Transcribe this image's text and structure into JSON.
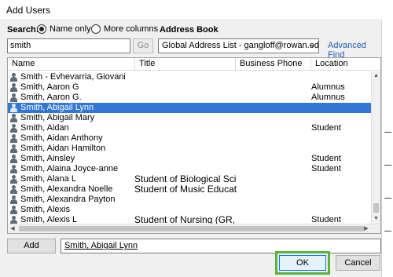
{
  "window": {
    "title": "Add Users"
  },
  "search": {
    "label": "Search:",
    "mode_options": [
      {
        "label": "Name only",
        "checked": true
      },
      {
        "label": "More columns",
        "checked": false
      }
    ],
    "value": "smith",
    "go_label": "Go"
  },
  "address_book": {
    "label": "Address Book",
    "selected": "Global Address List - gangloff@rowan.edu",
    "advanced_find_label": "Advanced Find"
  },
  "columns": [
    "Name",
    "Title",
    "Business Phone",
    "Location"
  ],
  "rows": [
    {
      "name": "Smith - Evhevarria, Giovani",
      "title": "",
      "phone": "",
      "location": ""
    },
    {
      "name": "Smith, Aaron G",
      "title": "",
      "phone": "",
      "location": "Alumnus"
    },
    {
      "name": "Smith, Aaron G.",
      "title": "",
      "phone": "",
      "location": "Alumnus"
    },
    {
      "name": "Smith, Abigail Lynn",
      "title": "",
      "phone": "",
      "location": "",
      "selected": true
    },
    {
      "name": "Smith, Abigail Mary",
      "title": "",
      "phone": "",
      "location": ""
    },
    {
      "name": "Smith, Aidan",
      "title": "",
      "phone": "",
      "location": "Student"
    },
    {
      "name": "Smith, Aidan Anthony",
      "title": "",
      "phone": "",
      "location": ""
    },
    {
      "name": "Smith, Aidan Hamilton",
      "title": "",
      "phone": "",
      "location": ""
    },
    {
      "name": "Smith, Ainsley",
      "title": "",
      "phone": "",
      "location": "Student"
    },
    {
      "name": "Smith, Alaina Joyce-anne",
      "title": "",
      "phone": "",
      "location": "Student"
    },
    {
      "name": "Smith, Alana L",
      "title": "Student of Biological Scien...",
      "phone": "",
      "location": ""
    },
    {
      "name": "Smith, Alexandra Noelle",
      "title": "Student of Music Educatio...",
      "phone": "",
      "location": ""
    },
    {
      "name": "Smith, Alexandra Payton",
      "title": "",
      "phone": "",
      "location": ""
    },
    {
      "name": "Smith, Alexis",
      "title": "",
      "phone": "",
      "location": ""
    },
    {
      "name": "Smith, Alexis L",
      "title": "Student of Nursing (GR, GR)",
      "phone": "",
      "location": "Student"
    }
  ],
  "add": {
    "button_label": "Add",
    "value": "Smith, Abigail Lynn"
  },
  "buttons": {
    "ok_label": "OK",
    "cancel_label": "Cancel"
  },
  "icons": {
    "person": "person-icon",
    "dropdown": "chevron-down-icon",
    "scroll_up": "scroll-up-arrow-icon",
    "scroll_down": "scroll-down-arrow-icon",
    "scroll_left": "scroll-left-arrow-icon",
    "scroll_right": "scroll-right-arrow-icon"
  },
  "colors": {
    "selection": "#3377d4",
    "link": "#1f5eb8",
    "ok_highlight": "#5ab43c"
  }
}
